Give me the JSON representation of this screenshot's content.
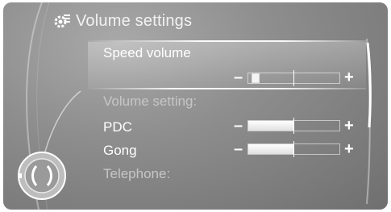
{
  "header": {
    "title": "Volume settings",
    "icon": "gear-icon"
  },
  "menu": {
    "speed_volume": {
      "label": "Speed volume",
      "level": 0.0
    },
    "section_label": "Volume setting:",
    "items": [
      {
        "label": "PDC",
        "level": 0.5
      },
      {
        "label": "Gong",
        "level": 0.5
      }
    ],
    "telephone_label": "Telephone:"
  },
  "controls": {
    "minus": "–",
    "plus": "+"
  }
}
